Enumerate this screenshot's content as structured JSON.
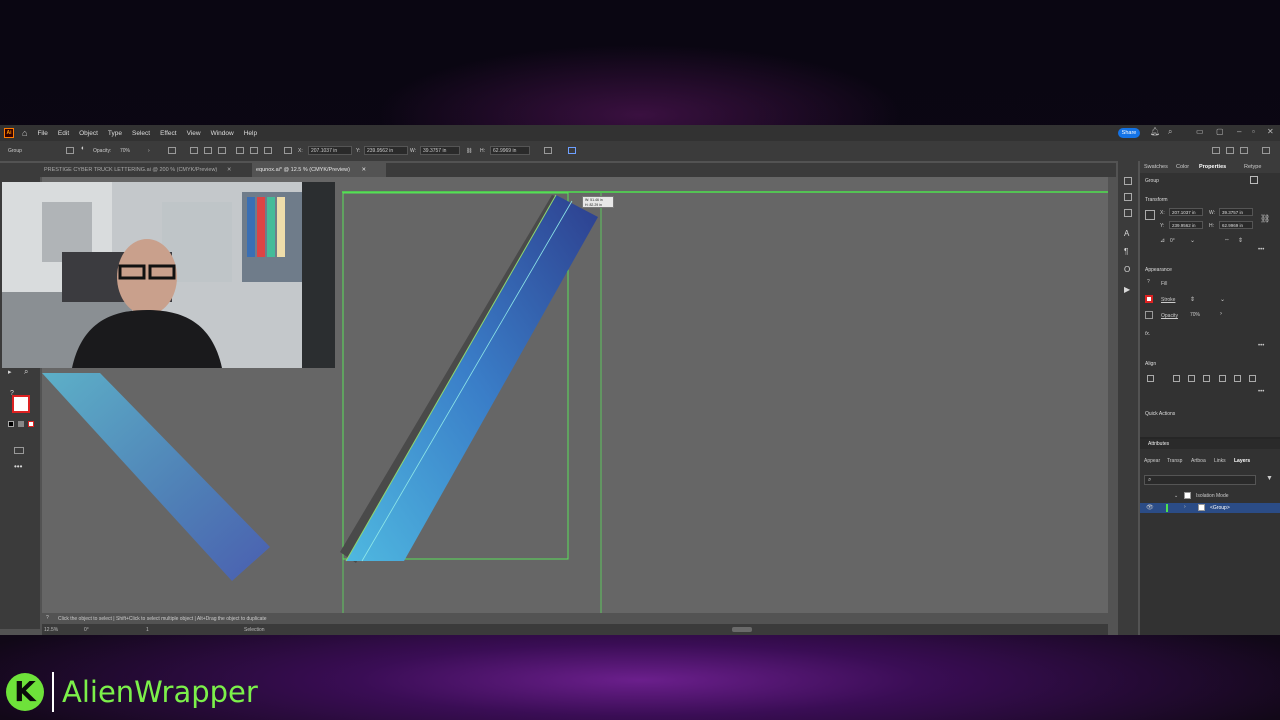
{
  "menubar": {
    "app_logo": "Ai",
    "items": [
      "File",
      "Edit",
      "Object",
      "Type",
      "Select",
      "Effect",
      "View",
      "Window",
      "Help"
    ],
    "share_label": "Share"
  },
  "control_bar": {
    "selection_type": "Group",
    "opacity_label": "Opacity:",
    "opacity_value": "70%",
    "x_label": "X:",
    "x_value": "207.1037 in",
    "y_label": "Y:",
    "y_value": "239.9562 in",
    "w_label": "W:",
    "w_value": "39.3757 in",
    "h_label": "H:",
    "h_value": "62.9969 in"
  },
  "tabs": [
    {
      "label": "PRESTIGE CYBER TRUCK LETTERING.ai @ 200 % (CMYK/Preview)"
    },
    {
      "label": "equnox.ai* @ 12.5 % (CMYK/Preview)"
    }
  ],
  "canvas": {
    "measure_tooltip_w": "W: 51.46 in",
    "measure_tooltip_h": "H: 82.29 in"
  },
  "status": {
    "hint": "Click the object to select  |  Shift+Click to select multiple object  |  Alt+Drag the object to duplicate",
    "zoom": "12.5%",
    "angle": "0°",
    "artboard": "1",
    "tool": "Selection"
  },
  "panel": {
    "tabs": [
      "Swatches",
      "Color",
      "Properties",
      "Retype"
    ],
    "active_tab": "Properties",
    "group_label": "Group",
    "transform_label": "Transform",
    "x_label": "X:",
    "x_value": "207.1037 in",
    "y_label": "Y:",
    "y_value": "239.9562 in",
    "w_label": "W:",
    "w_value": "39.3757 in",
    "h_label": "H:",
    "h_value": "62.9969 in",
    "rotate_value": "0°",
    "appearance_label": "Appearance",
    "fill_label": "Fill",
    "stroke_label": "Stroke",
    "opacity_label": "Opacity",
    "opacity_value": "70%",
    "fx_label": "fx.",
    "align_label": "Align",
    "quick_actions_label": "Quick Actions"
  },
  "layers_panel": {
    "header": "Attributes",
    "tabs": [
      "Appear",
      "Transp",
      "Artboa",
      "Links",
      "Layers"
    ],
    "active_tab": "Layers",
    "rows": [
      {
        "label": "Isolation Mode"
      },
      {
        "label": "<Group>"
      }
    ]
  },
  "brand": {
    "icon_letter": "K",
    "name": "AlienWrapper",
    "color": "#7cf04a"
  }
}
